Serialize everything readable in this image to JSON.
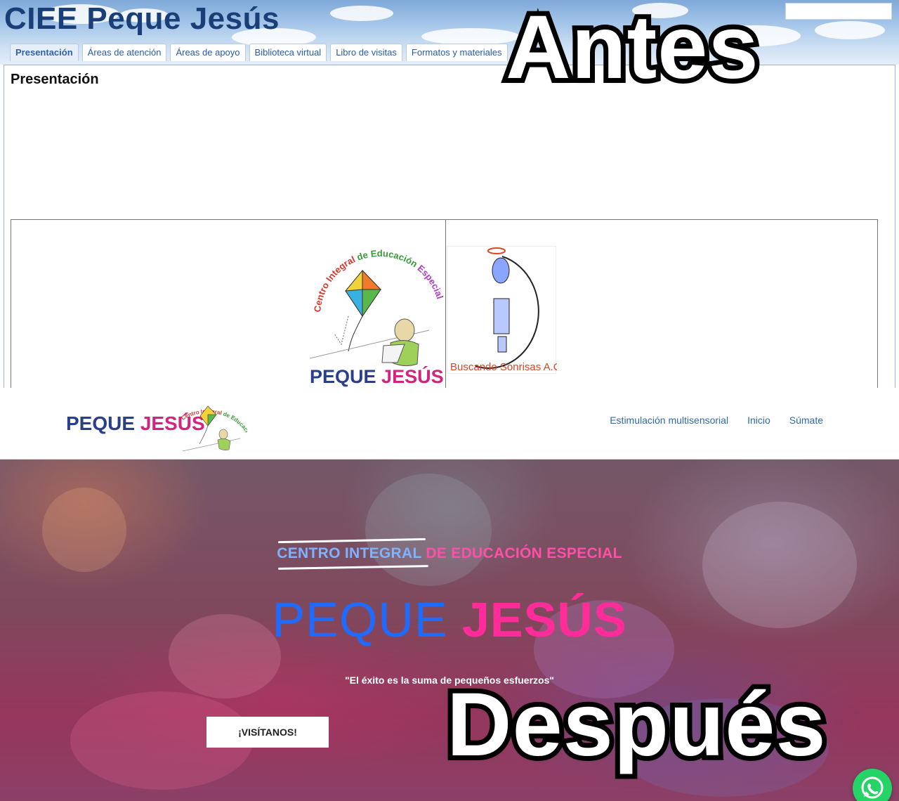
{
  "before": {
    "label": "Antes",
    "site_title": "CIEE Peque Jesús",
    "tabs": [
      {
        "label": "Presentación",
        "active": true
      },
      {
        "label": "Áreas de atención"
      },
      {
        "label": "Áreas de apoyo"
      },
      {
        "label": "Biblioteca virtual"
      },
      {
        "label": "Libro de visitas"
      },
      {
        "label": "Formatos y materiales"
      }
    ],
    "page_title": "Presentación",
    "logo_ciee": {
      "arc_text_a": "Centro Integral de Educación Especial",
      "name_a": "PEQUE",
      "name_b": "JESÚS"
    },
    "logo_buscando": {
      "text": "Buscando Sonrisas A.C"
    }
  },
  "after": {
    "label": "Después",
    "nav": {
      "logo_name_a": "PEQUE",
      "logo_name_b": "JESÚS",
      "logo_arc": "Centro Integral de Educación Especial",
      "menu": [
        "Estimulación multisensorial",
        "Inicio",
        "Súmate"
      ]
    },
    "hero": {
      "subtitle_a": "CENTRO INTEGRAL",
      "subtitle_b": "DE EDUCACIÓN ESPECIAL",
      "title_a": "PEQUE",
      "title_b": "JESÚS",
      "quote": "\"El éxito es la suma de pequeños esfuerzos\"",
      "button": "¡VISÍTANOS!"
    }
  },
  "colors": {
    "old_title": "#1a3f78",
    "blue_accent": "#1f6bff",
    "pink_accent": "#ff2c9a",
    "whatsapp": "#25d366"
  },
  "icons": [
    "whatsapp-icon",
    "kite-icon",
    "angel-icon"
  ]
}
